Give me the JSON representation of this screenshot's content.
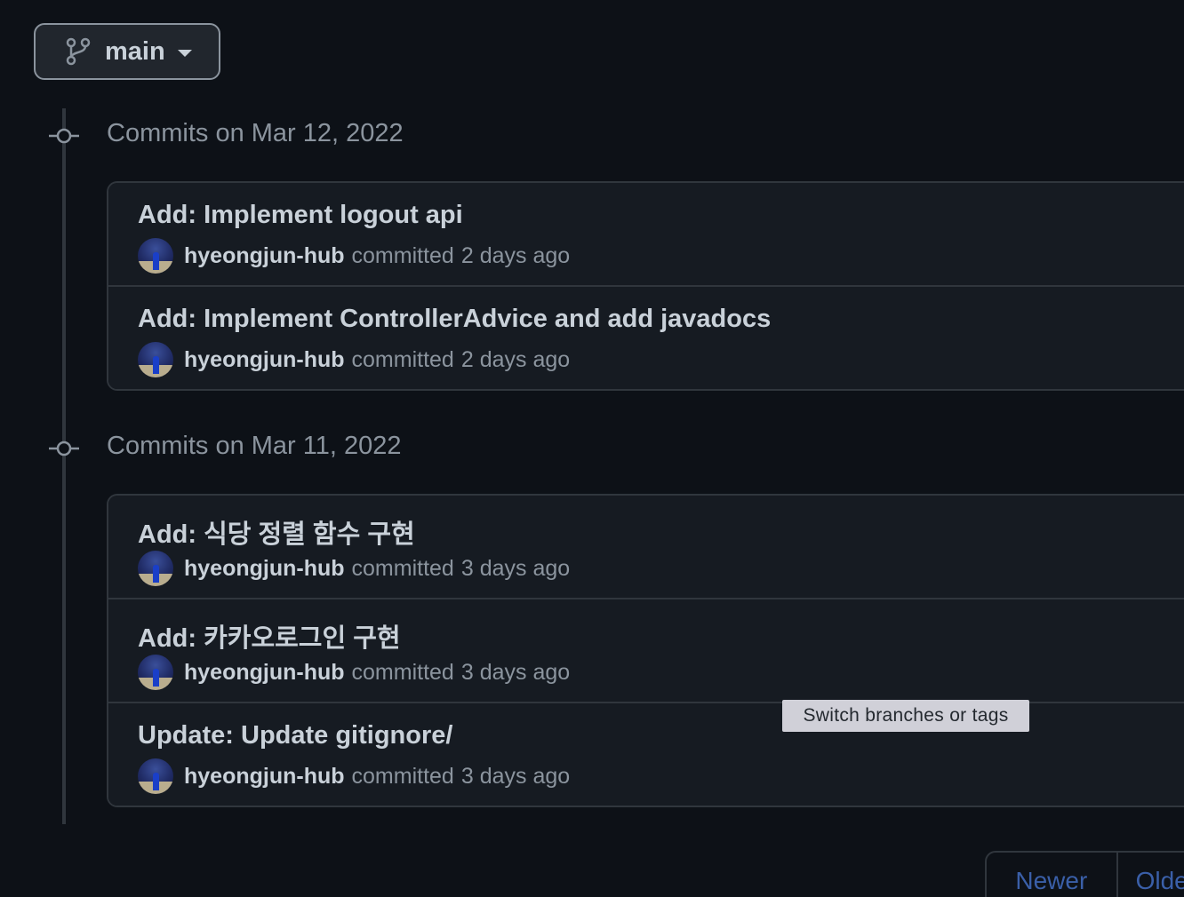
{
  "branch": {
    "label": "main",
    "icon": "git-branch-icon",
    "tooltip": "Switch branches or tags"
  },
  "groups": [
    {
      "title": "Commits on Mar 12, 2022",
      "commits": [
        {
          "message": "Add: Implement logout api",
          "author": "hyeongjun-hub",
          "verb": "committed",
          "time": "2 days ago"
        },
        {
          "message": "Add: Implement ControllerAdvice and add javadocs",
          "author": "hyeongjun-hub",
          "verb": "committed",
          "time": "2 days ago"
        }
      ]
    },
    {
      "title": "Commits on Mar 11, 2022",
      "commits": [
        {
          "message": "Add: 식당 정렬 함수 구현",
          "author": "hyeongjun-hub",
          "verb": "committed",
          "time": "3 days ago"
        },
        {
          "message": "Add: 카카오로그인 구현",
          "author": "hyeongjun-hub",
          "verb": "committed",
          "time": "3 days ago"
        },
        {
          "message": "Update: Update gitignore/",
          "author": "hyeongjun-hub",
          "verb": "committed",
          "time": "3 days ago"
        }
      ]
    }
  ],
  "pagination": {
    "newer": "Newer",
    "older": "Older"
  },
  "colors": {
    "background": "#0d1117",
    "border": "#30363d",
    "muted": "#8b949e",
    "link": "#3a5fa8"
  }
}
